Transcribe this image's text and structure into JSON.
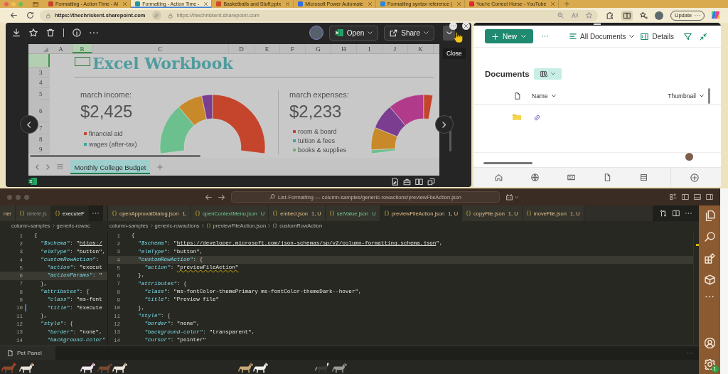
{
  "browser": {
    "tabs": [
      {
        "title": "Formatting - Action Time - AI",
        "selected": false,
        "color": "#c8452d"
      },
      {
        "title": "Formatting - Action Time -",
        "selected": true,
        "color": "#1d9aa0"
      },
      {
        "title": "Basketballs and Stuff.pptx",
        "selected": false,
        "color": "#d24726"
      },
      {
        "title": "Microsoft Power Automate",
        "selected": false,
        "color": "#2f6fe0"
      },
      {
        "title": "Formatting syntax reference |",
        "selected": false,
        "color": "#2b88d8"
      },
      {
        "title": "You're Correct Horse - YouTube",
        "selected": false,
        "color": "#e0282e"
      }
    ],
    "address": {
      "url": "https://thechriskent.sharepoint.com",
      "second_url": "https://thechriskent.sharepoint.com"
    },
    "update_button": "Update"
  },
  "preview": {
    "open_button": "Open",
    "share_button": "Share",
    "tooltip": "Close",
    "sheet": {
      "title": "Excel Workbook",
      "columns": [
        {
          "label": "A",
          "selected": false
        },
        {
          "label": "B",
          "selected": true
        },
        {
          "label": "C",
          "selected": false
        },
        {
          "label": "D",
          "selected": false
        },
        {
          "label": "E",
          "selected": false
        },
        {
          "label": "F",
          "selected": false
        },
        {
          "label": "G",
          "selected": false
        },
        {
          "label": "H",
          "selected": false
        },
        {
          "label": "I",
          "selected": false
        },
        {
          "label": "J",
          "selected": false
        },
        {
          "label": "K",
          "selected": false
        }
      ],
      "rows": [
        {
          "selected": true
        },
        {
          "label": "3",
          "selected": false
        },
        {
          "label": "4",
          "selected": false
        },
        {
          "label": "5",
          "selected": false
        },
        {
          "label": "6",
          "selected": false
        },
        {
          "label": "7",
          "selected": false
        },
        {
          "label": "8",
          "selected": false
        },
        {
          "label": "9",
          "selected": false
        }
      ],
      "income": {
        "heading": "march income:",
        "amount": "$2,425",
        "legend": [
          {
            "label": "financial aid",
            "color": "#c4452c"
          },
          {
            "label": "wages (after-tax)",
            "color": "#3aa6a0"
          }
        ]
      },
      "expenses": {
        "heading": "march expenses:",
        "amount": "$2,233",
        "legend": [
          {
            "label": "room & board",
            "color": "#c4452c"
          },
          {
            "label": "tuition & fees",
            "color": "#3aa6a0"
          },
          {
            "label": "books & supplies",
            "color": "#5cb87a"
          }
        ]
      },
      "sheet_tabs": [
        {
          "label": "Monthly College Budget",
          "selected": true
        }
      ]
    }
  },
  "library": {
    "new_button": "New",
    "view_selector": "All Documents",
    "details_button": "Details",
    "heading": "Documents",
    "columns": [
      "Name",
      "Thumbnail"
    ]
  },
  "editor": {
    "command_center": "List-Formatting — column-samples/generic-rowactions/previewFileAction.json",
    "left_cut_tab": {
      "name": "ner",
      "kind": "problem"
    },
    "left_tabs": [
      {
        "name": "delete.js",
        "kind": "muted",
        "selected": false
      },
      {
        "name": "executeF",
        "kind": "plain",
        "selected": true
      }
    ],
    "right_tabs": [
      {
        "name": "openApprovalDialog.json",
        "status": "1,",
        "kind": "problem",
        "selected": false
      },
      {
        "name": "openContextMenu.json",
        "status": "U",
        "kind": "untracked",
        "selected": false
      },
      {
        "name": "embed.json",
        "status": "1, U",
        "kind": "problem",
        "selected": false
      },
      {
        "name": "setValue.json",
        "status": "U",
        "kind": "untracked",
        "selected": false
      },
      {
        "name": "previewFileAction.json",
        "status": "1, U",
        "kind": "problem",
        "selected": true
      },
      {
        "name": "copyFile.json",
        "status": "1, U",
        "kind": "problem",
        "selected": false
      },
      {
        "name": "moveFile.json",
        "status": "1, U",
        "kind": "problem",
        "selected": false
      }
    ],
    "left_breadcrumbs": [
      "column-samples",
      "generic-rowac"
    ],
    "right_breadcrumbs": [
      {
        "label": "column-samples",
        "kind": "folder"
      },
      {
        "label": "generic-rowactions",
        "kind": "folder"
      },
      {
        "label": "previewFileAction.json",
        "kind": "file"
      },
      {
        "label": "customRowAction",
        "kind": "symbol"
      }
    ],
    "left_lines": [
      {
        "number": "1",
        "highlighted": false,
        "modified": false,
        "tokens": [
          {
            "kind": "punct",
            "text": "{"
          }
        ]
      },
      {
        "number": "2",
        "highlighted": false,
        "modified": false,
        "tokens": [
          {
            "kind": "key",
            "text": "  \"$schema\""
          },
          {
            "kind": "punct",
            "text": ": "
          },
          {
            "kind": "string",
            "text": "\""
          },
          {
            "kind": "url",
            "text": "https:/"
          }
        ]
      },
      {
        "number": "3",
        "highlighted": false,
        "modified": false,
        "tokens": [
          {
            "kind": "key",
            "text": "  \"elmType\""
          },
          {
            "kind": "punct",
            "text": ": "
          },
          {
            "kind": "string",
            "text": "\"button\""
          },
          {
            "kind": "punct",
            "text": ","
          }
        ]
      },
      {
        "number": "4",
        "highlighted": false,
        "modified": false,
        "tokens": [
          {
            "kind": "key",
            "text": "  \"customRowAction\""
          },
          {
            "kind": "punct",
            "text": ":"
          }
        ]
      },
      {
        "number": "5",
        "highlighted": false,
        "modified": false,
        "tokens": [
          {
            "kind": "key",
            "text": "    \"action\""
          },
          {
            "kind": "punct",
            "text": ": "
          },
          {
            "kind": "string",
            "text": "\"execut"
          }
        ]
      },
      {
        "number": "6",
        "highlighted": true,
        "modified": false,
        "tokens": [
          {
            "kind": "key",
            "text": "    \"actionParams\""
          },
          {
            "kind": "punct",
            "text": ": "
          },
          {
            "kind": "string",
            "text": "\""
          }
        ]
      },
      {
        "number": "7",
        "highlighted": false,
        "modified": false,
        "tokens": [
          {
            "kind": "punct",
            "text": "  },"
          }
        ]
      },
      {
        "number": "8",
        "highlighted": false,
        "modified": false,
        "tokens": [
          {
            "kind": "key",
            "text": "  \"attributes\""
          },
          {
            "kind": "punct",
            "text": ": {"
          }
        ]
      },
      {
        "number": "9",
        "highlighted": false,
        "modified": false,
        "tokens": [
          {
            "kind": "key",
            "text": "    \"class\""
          },
          {
            "kind": "punct",
            "text": ": "
          },
          {
            "kind": "string",
            "text": "\"ms-font"
          }
        ]
      },
      {
        "number": "10",
        "highlighted": false,
        "modified": true,
        "tokens": [
          {
            "kind": "key",
            "text": "    \"title\""
          },
          {
            "kind": "punct",
            "text": ": "
          },
          {
            "kind": "string",
            "text": "\"Execute"
          }
        ]
      },
      {
        "number": "11",
        "highlighted": false,
        "modified": false,
        "tokens": [
          {
            "kind": "punct",
            "text": "  },"
          }
        ]
      },
      {
        "number": "12",
        "highlighted": false,
        "modified": false,
        "tokens": [
          {
            "kind": "key",
            "text": "  \"style\""
          },
          {
            "kind": "punct",
            "text": ": {"
          }
        ]
      },
      {
        "number": "13",
        "highlighted": false,
        "modified": false,
        "tokens": [
          {
            "kind": "key",
            "text": "    \"border\""
          },
          {
            "kind": "punct",
            "text": ": "
          },
          {
            "kind": "string",
            "text": "\"none\""
          },
          {
            "kind": "punct",
            "text": ","
          }
        ]
      },
      {
        "number": "14",
        "highlighted": false,
        "modified": false,
        "tokens": [
          {
            "kind": "key",
            "text": "    \"background-color\""
          }
        ]
      }
    ],
    "right_lines": [
      {
        "number": "1",
        "highlighted": false,
        "tokens": [
          {
            "kind": "punct",
            "text": "{"
          }
        ]
      },
      {
        "number": "2",
        "highlighted": false,
        "tokens": [
          {
            "kind": "key",
            "text": "  \"$schema\""
          },
          {
            "kind": "punct",
            "text": ": "
          },
          {
            "kind": "string",
            "text": "\""
          },
          {
            "kind": "url",
            "text": "https://developer.microsoft.com/json-schemas/sp/v2/column-formatting.schema.json"
          },
          {
            "kind": "string",
            "text": "\""
          },
          {
            "kind": "punct",
            "text": ","
          }
        ]
      },
      {
        "number": "3",
        "highlighted": false,
        "tokens": [
          {
            "kind": "key",
            "text": "  \"elmType\""
          },
          {
            "kind": "punct",
            "text": ": "
          },
          {
            "kind": "string",
            "text": "\"button\""
          },
          {
            "kind": "punct",
            "text": ","
          }
        ]
      },
      {
        "number": "4",
        "highlighted": true,
        "tokens": [
          {
            "kind": "key",
            "text": "  \"customRowAction\""
          },
          {
            "kind": "punct",
            "text": ": {"
          }
        ]
      },
      {
        "number": "5",
        "highlighted": false,
        "tokens": [
          {
            "kind": "key",
            "text": "    \"action\""
          },
          {
            "kind": "punct",
            "text": ": "
          },
          {
            "kind": "warned",
            "text": "\"previewFileAction\""
          }
        ]
      },
      {
        "number": "6",
        "highlighted": false,
        "tokens": [
          {
            "kind": "punct",
            "text": "  },"
          }
        ]
      },
      {
        "number": "7",
        "highlighted": false,
        "tokens": [
          {
            "kind": "key",
            "text": "  \"attributes\""
          },
          {
            "kind": "punct",
            "text": ": {"
          }
        ]
      },
      {
        "number": "8",
        "highlighted": false,
        "tokens": [
          {
            "kind": "key",
            "text": "    \"class\""
          },
          {
            "kind": "punct",
            "text": ": "
          },
          {
            "kind": "string",
            "text": "\"ms-fontColor-themePrimary ms-fontColor-themeDark--hover\""
          },
          {
            "kind": "punct",
            "text": ","
          }
        ]
      },
      {
        "number": "9",
        "highlighted": false,
        "tokens": [
          {
            "kind": "key",
            "text": "    \"title\""
          },
          {
            "kind": "punct",
            "text": ": "
          },
          {
            "kind": "string",
            "text": "\"Preview file\""
          }
        ]
      },
      {
        "number": "10",
        "highlighted": false,
        "tokens": [
          {
            "kind": "punct",
            "text": "  },"
          }
        ]
      },
      {
        "number": "11",
        "highlighted": false,
        "tokens": [
          {
            "kind": "key",
            "text": "  \"style\""
          },
          {
            "kind": "punct",
            "text": ": {"
          }
        ]
      },
      {
        "number": "12",
        "highlighted": false,
        "tokens": [
          {
            "kind": "key",
            "text": "    \"border\""
          },
          {
            "kind": "punct",
            "text": ": "
          },
          {
            "kind": "string",
            "text": "\"none\""
          },
          {
            "kind": "punct",
            "text": ","
          }
        ]
      },
      {
        "number": "13",
        "highlighted": false,
        "tokens": [
          {
            "kind": "key",
            "text": "    \"background-color\""
          },
          {
            "kind": "punct",
            "text": ": "
          },
          {
            "kind": "string",
            "text": "\"transparent\""
          },
          {
            "kind": "punct",
            "text": ","
          }
        ]
      },
      {
        "number": "14",
        "highlighted": false,
        "tokens": [
          {
            "kind": "key",
            "text": "    \"cursor\""
          },
          {
            "kind": "punct",
            "text": ": "
          },
          {
            "kind": "string",
            "text": "\"pointer\""
          }
        ]
      }
    ],
    "panel_title": "Pet Panel",
    "settings_badge": "1"
  }
}
